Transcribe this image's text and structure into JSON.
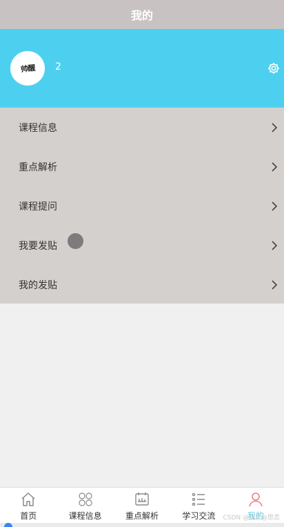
{
  "header": {
    "title": "我的"
  },
  "profile": {
    "avatar_text": "帅醒",
    "username": "2"
  },
  "menu": {
    "items": [
      {
        "label": "课程信息"
      },
      {
        "label": "重点解析"
      },
      {
        "label": "课程提问"
      },
      {
        "label": "我要发贴"
      },
      {
        "label": "我的发贴"
      }
    ]
  },
  "tabbar": {
    "tabs": [
      {
        "label": "首页",
        "icon": "home-icon"
      },
      {
        "label": "课程信息",
        "icon": "grid-icon"
      },
      {
        "label": "重点解析",
        "icon": "board-icon"
      },
      {
        "label": "学习交流",
        "icon": "list-icon"
      },
      {
        "label": "我的",
        "icon": "user-icon"
      }
    ]
  },
  "watermark": "CSDN @想念@思恋",
  "colors": {
    "accent": "#4dd0f0",
    "titlebar": "#c8c3c2",
    "menu_bg": "#d3d0ce"
  }
}
